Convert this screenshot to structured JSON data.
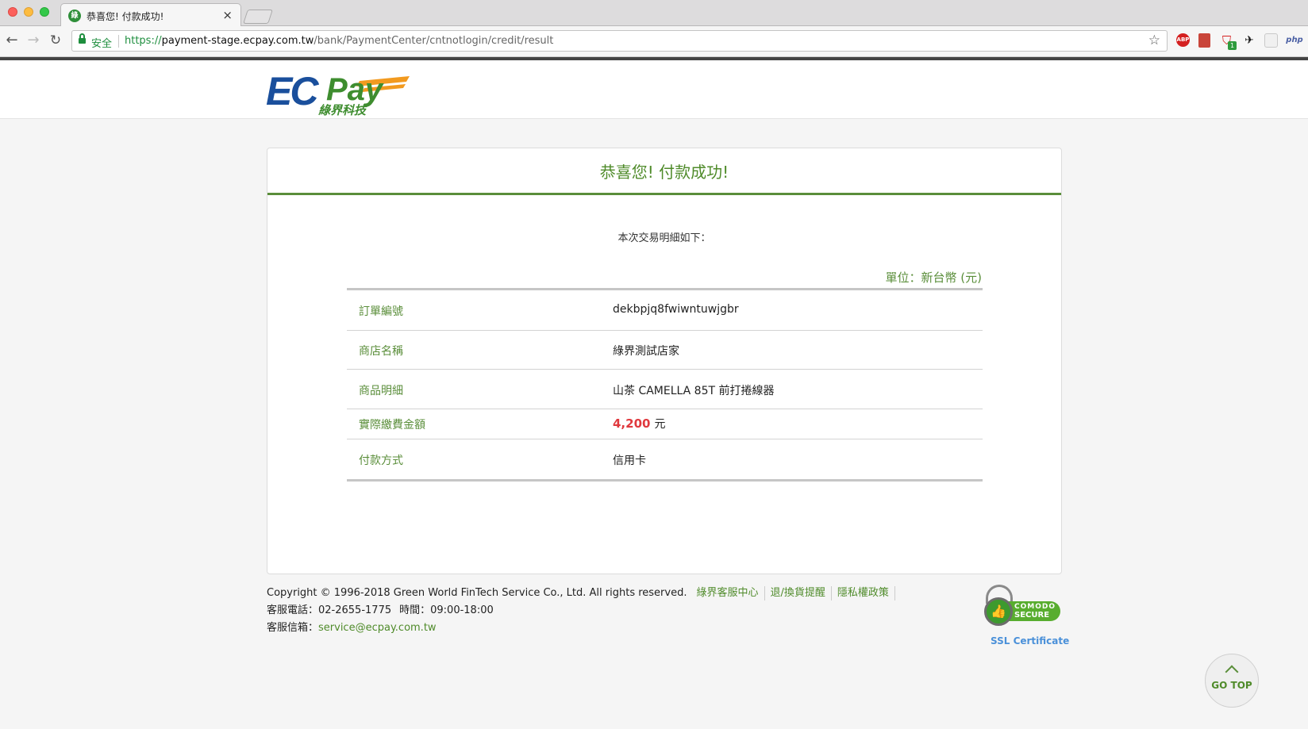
{
  "browser": {
    "tab_title": "恭喜您! 付款成功!",
    "tab_favicon": "綠",
    "tab_close": "×",
    "secure_label": "安全",
    "url_scheme": "https://",
    "url_host": "payment-stage.ecpay.com.tw",
    "url_path": "/bank/PaymentCenter/cntnotlogin/credit/result",
    "extensions": [
      "adblock-icon",
      "bookmark-icon",
      "shield-icon",
      "bird-icon",
      "ghost-icon",
      "php-icon"
    ],
    "ext_abp": "ABP",
    "ext_shield_badge": "1",
    "ext_php": "php"
  },
  "header": {
    "logo_text": "ECPay",
    "logo_sub": "綠界科技",
    "colors": {
      "blue": "#1a4f9c",
      "green": "#3e8d2f",
      "orange": "#f29a1f"
    }
  },
  "result": {
    "title": "恭喜您! 付款成功!",
    "intro": "本次交易明細如下：",
    "unit": "單位：新台幣 (元)",
    "rows": [
      {
        "label": "訂單編號",
        "value": "dekbpjq8fwiwntuwjgbr"
      },
      {
        "label": "商店名稱",
        "value": "綠界測試店家"
      },
      {
        "label": "商品明細",
        "value": "山茶 CAMELLA 85T 前打捲線器"
      },
      {
        "label": "實際繳費金額",
        "amount": "4,200",
        "currency": "元"
      },
      {
        "label": "付款方式",
        "value": "信用卡"
      }
    ],
    "colors": {
      "accent": "#5a8e3a",
      "amount": "#e0393e"
    }
  },
  "footer": {
    "copyright": "Copyright © 1996-2018 Green World FinTech Service Co., Ltd. All rights reserved.",
    "links": [
      "綠界客服中心",
      "退/換貨提醒",
      "隱私權政策"
    ],
    "phone_label": "客服電話：",
    "phone": "02-2655-1775",
    "hours_label": "時間：",
    "hours": "09:00-18:00",
    "email_label": "客服信箱：",
    "email": "service@ecpay.com.tw"
  },
  "ssl": {
    "brand": "COMODO",
    "secure": "SECURE",
    "caption": "SSL Certificate"
  },
  "go_top": "GO TOP"
}
